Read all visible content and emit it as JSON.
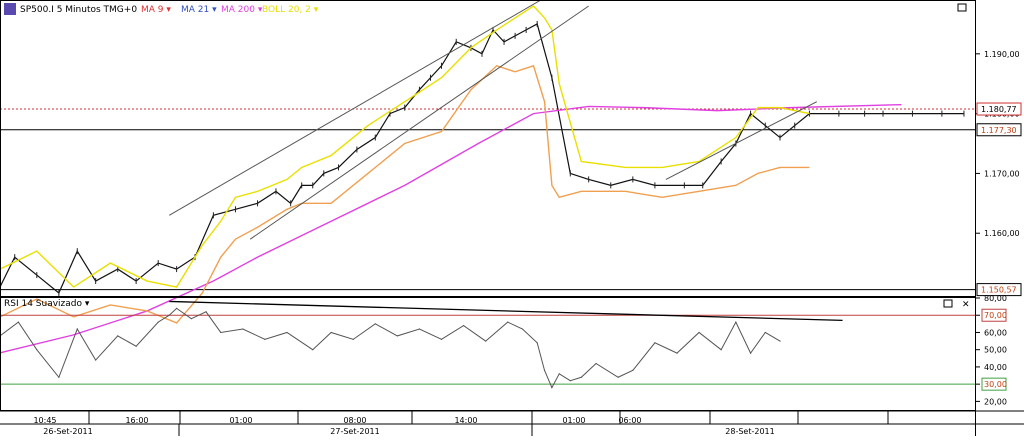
{
  "chart_data": [
    {
      "type": "line",
      "panel": "price",
      "header": {
        "symbol": "SP500.I",
        "timeframe": "5 Minutos",
        "timezone": "TMG+0",
        "indicators": [
          {
            "label": "MA 9",
            "color": "#e03030"
          },
          {
            "label": "MA 21",
            "color": "#3050c0"
          },
          {
            "label": "MA 200",
            "color": "#e040e0"
          },
          {
            "label": "BOLL 20, 2",
            "color": "#e8e000"
          }
        ]
      },
      "x_time_labels": [
        "10:45",
        "16:00",
        "01:00",
        "08:00",
        "14:00",
        "01:00",
        "06:00"
      ],
      "x_date_labels": [
        "26-Set-2011",
        "27-Set-2011",
        "28-Set-2011"
      ],
      "y_ticks": [
        "1.190,00",
        "1.180,00",
        "1.170,00",
        "1.160,00"
      ],
      "ylim": [
        1149.5,
        1199
      ],
      "grid": false,
      "price_labels": [
        {
          "label": "1.180,77",
          "value": 1180.77,
          "style": "dotted",
          "color": "#d03030"
        },
        {
          "label": "1.177,30",
          "value": 1177.3,
          "style": "solid",
          "color": "#000000"
        },
        {
          "label": "1.150,57",
          "value": 1150.57,
          "style": "solid",
          "color": "#000000"
        }
      ],
      "series": [
        {
          "name": "SP500.I",
          "color": "#111111",
          "x": [
            0,
            4,
            10,
            16,
            21,
            26,
            32,
            37,
            43,
            48,
            53,
            58,
            64,
            70,
            75,
            79,
            82,
            85,
            88,
            92,
            97,
            102,
            106,
            110,
            114,
            117,
            120,
            124,
            128,
            131,
            134,
            137,
            140,
            143,
            146,
            150,
            155,
            160,
            166,
            172,
            178,
            186,
            191,
            196,
            200,
            204,
            208,
            212,
            216,
            220,
            228,
            235,
            240,
            248,
            256,
            262
          ],
          "y": [
            1151,
            1156,
            1153,
            1150,
            1157,
            1152,
            1154,
            1152,
            1155,
            1154,
            1156,
            1163,
            1164,
            1165,
            1167,
            1165,
            1168,
            1168,
            1170,
            1171,
            1174,
            1176,
            1180,
            1181,
            1184,
            1186,
            1188,
            1192,
            1191,
            1190,
            1194,
            1192,
            1193,
            1194,
            1195,
            1186,
            1170,
            1169,
            1168,
            1169,
            1168,
            1168,
            1168,
            1172,
            1175,
            1180,
            1178,
            1176,
            1178,
            1180,
            1180,
            1180,
            1180,
            1180,
            1180,
            1180
          ]
        },
        {
          "name": "MA 200",
          "color": "#e040e0",
          "x": [
            0,
            20,
            40,
            58,
            70,
            90,
            110,
            130,
            145,
            160,
            175,
            195,
            215,
            245
          ],
          "y": [
            1140,
            1143,
            1147,
            1152,
            1156,
            1162,
            1168,
            1175,
            1180,
            1181.2,
            1181,
            1180.5,
            1181,
            1181.5
          ]
        },
        {
          "name": "BOLL 20, 2 (upper)",
          "color": "#e8e000",
          "x": [
            0,
            10,
            20,
            30,
            40,
            48,
            55,
            60,
            64,
            70,
            78,
            82,
            90,
            100,
            110,
            120,
            128,
            135,
            140,
            145,
            148,
            150,
            152,
            158,
            170,
            180,
            190,
            200,
            206,
            212,
            220
          ],
          "y": [
            1154,
            1157,
            1151,
            1155,
            1152,
            1151,
            1158,
            1162,
            1166,
            1167,
            1169,
            1171,
            1173,
            1178,
            1182,
            1186,
            1191,
            1194,
            1196,
            1198,
            1196,
            1194,
            1185,
            1172,
            1171,
            1171,
            1172,
            1176,
            1181,
            1181,
            1180
          ]
        },
        {
          "name": "BOLL 20, 2 (lower)",
          "color": "#f0a050",
          "x": [
            0,
            10,
            20,
            30,
            40,
            48,
            55,
            60,
            64,
            70,
            78,
            82,
            90,
            100,
            110,
            120,
            128,
            135,
            140,
            145,
            148,
            150,
            152,
            158,
            170,
            180,
            190,
            200,
            206,
            212,
            220
          ],
          "y": [
            1146,
            1149,
            1146,
            1148,
            1147,
            1145,
            1150,
            1156,
            1159,
            1161,
            1164,
            1165,
            1165,
            1170,
            1175,
            1177,
            1184,
            1188,
            1187,
            1188,
            1182,
            1168,
            1166,
            1167,
            1167,
            1166,
            1167,
            1168,
            1170,
            1171,
            1171
          ]
        }
      ],
      "annotations": {
        "trendlines": [
          {
            "from": [
              46,
              1163
            ],
            "to": [
              147,
              1199
            ],
            "color": "#555555"
          },
          {
            "from": [
              68,
              1159
            ],
            "to": [
              160,
              1198
            ],
            "color": "#555555"
          },
          {
            "from": [
              181,
              1169
            ],
            "to": [
              222,
              1182
            ],
            "color": "#555555"
          }
        ]
      }
    },
    {
      "type": "line",
      "panel": "oscillator",
      "title": "RSI 14 Suavizado",
      "y_ticks": [
        "80,00",
        "70,00",
        "60,00",
        "50,00",
        "40,00",
        "30,00",
        "20,00"
      ],
      "ylim": [
        15,
        80
      ],
      "levels": [
        {
          "label": "70,00",
          "value": 70,
          "color": "#c04040"
        },
        {
          "label": "30,00",
          "value": 30,
          "color": "#40a040"
        }
      ],
      "series": [
        {
          "name": "RSI 14",
          "color": "#555555",
          "x": [
            0,
            5,
            10,
            16,
            21,
            26,
            32,
            37,
            43,
            46,
            48,
            52,
            56,
            60,
            66,
            72,
            78,
            85,
            90,
            96,
            102,
            108,
            114,
            120,
            126,
            132,
            138,
            142,
            146,
            148,
            150,
            152,
            155,
            158,
            162,
            168,
            172,
            178,
            184,
            190,
            196,
            200,
            204,
            208,
            212
          ],
          "y": [
            58,
            66,
            50,
            34,
            62,
            44,
            58,
            52,
            66,
            70,
            74,
            68,
            72,
            60,
            62,
            56,
            60,
            50,
            60,
            56,
            65,
            58,
            62,
            56,
            64,
            55,
            66,
            62,
            54,
            38,
            28,
            36,
            32,
            34,
            42,
            34,
            38,
            54,
            48,
            60,
            50,
            66,
            48,
            60,
            55
          ]
        }
      ],
      "annotations": {
        "trendlines": [
          {
            "from": [
              46,
              78
            ],
            "to": [
              229,
              67
            ],
            "color": "#000000"
          }
        ]
      }
    }
  ]
}
